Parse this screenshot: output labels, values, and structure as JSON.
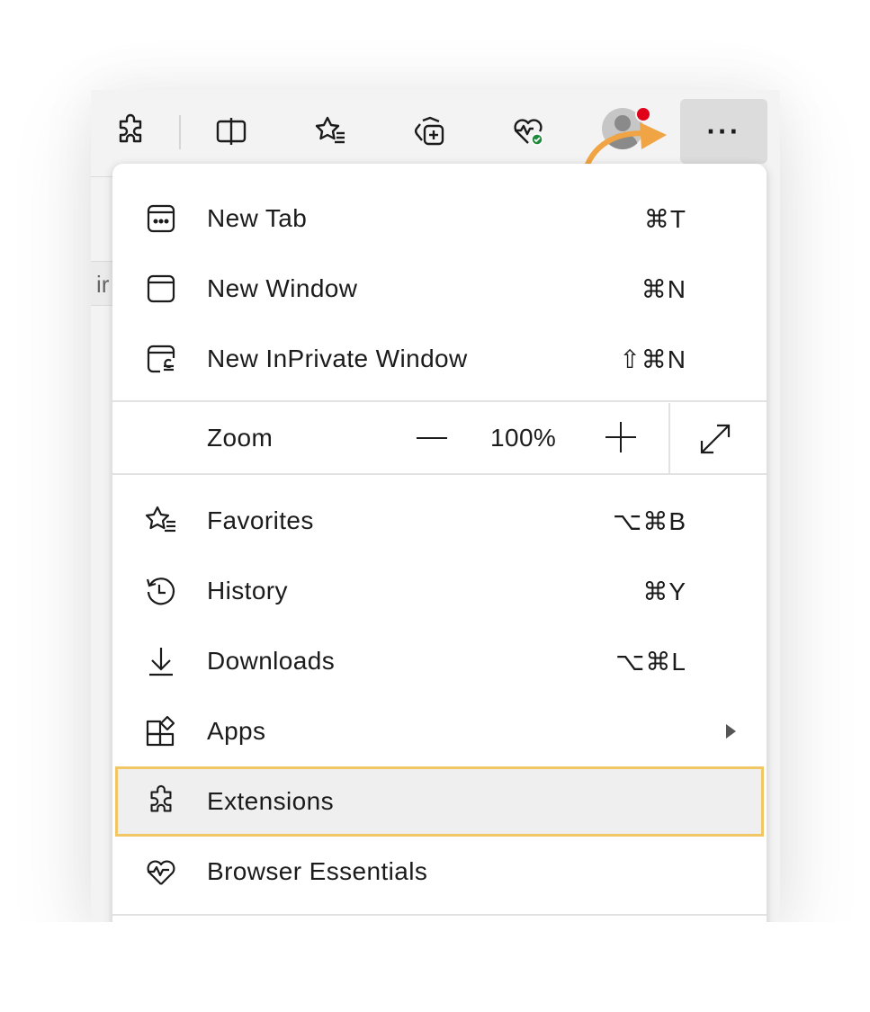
{
  "toolbar": {
    "buttons": [
      "extensions-icon",
      "split-screen-icon",
      "favorites-icon",
      "collections-icon",
      "browser-essentials-icon"
    ],
    "more_label": "···"
  },
  "page_fragment": {
    "text": "ir"
  },
  "menu": {
    "items_top": [
      {
        "label": "New Tab",
        "shortcut": "⌘T",
        "icon": "new-tab-icon"
      },
      {
        "label": "New Window",
        "shortcut": "⌘N",
        "icon": "new-window-icon"
      },
      {
        "label": "New InPrivate Window",
        "shortcut": "⇧⌘N",
        "icon": "inprivate-window-icon"
      }
    ],
    "zoom": {
      "label": "Zoom",
      "value": "100%"
    },
    "items_bottom": [
      {
        "label": "Favorites",
        "shortcut": "⌥⌘B",
        "icon": "favorites-icon"
      },
      {
        "label": "History",
        "shortcut": "⌘Y",
        "icon": "history-icon"
      },
      {
        "label": "Downloads",
        "shortcut": "⌥⌘L",
        "icon": "downloads-icon"
      },
      {
        "label": "Apps",
        "shortcut": "",
        "icon": "apps-icon"
      },
      {
        "label": "Extensions",
        "shortcut": "",
        "icon": "extensions-icon"
      },
      {
        "label": "Browser Essentials",
        "shortcut": "",
        "icon": "browser-essentials-icon"
      }
    ]
  },
  "colors": {
    "highlight_border": "#f1c664",
    "arrow": "#f0a443",
    "badge": "#e0001a",
    "check": "#1f8a3c"
  }
}
